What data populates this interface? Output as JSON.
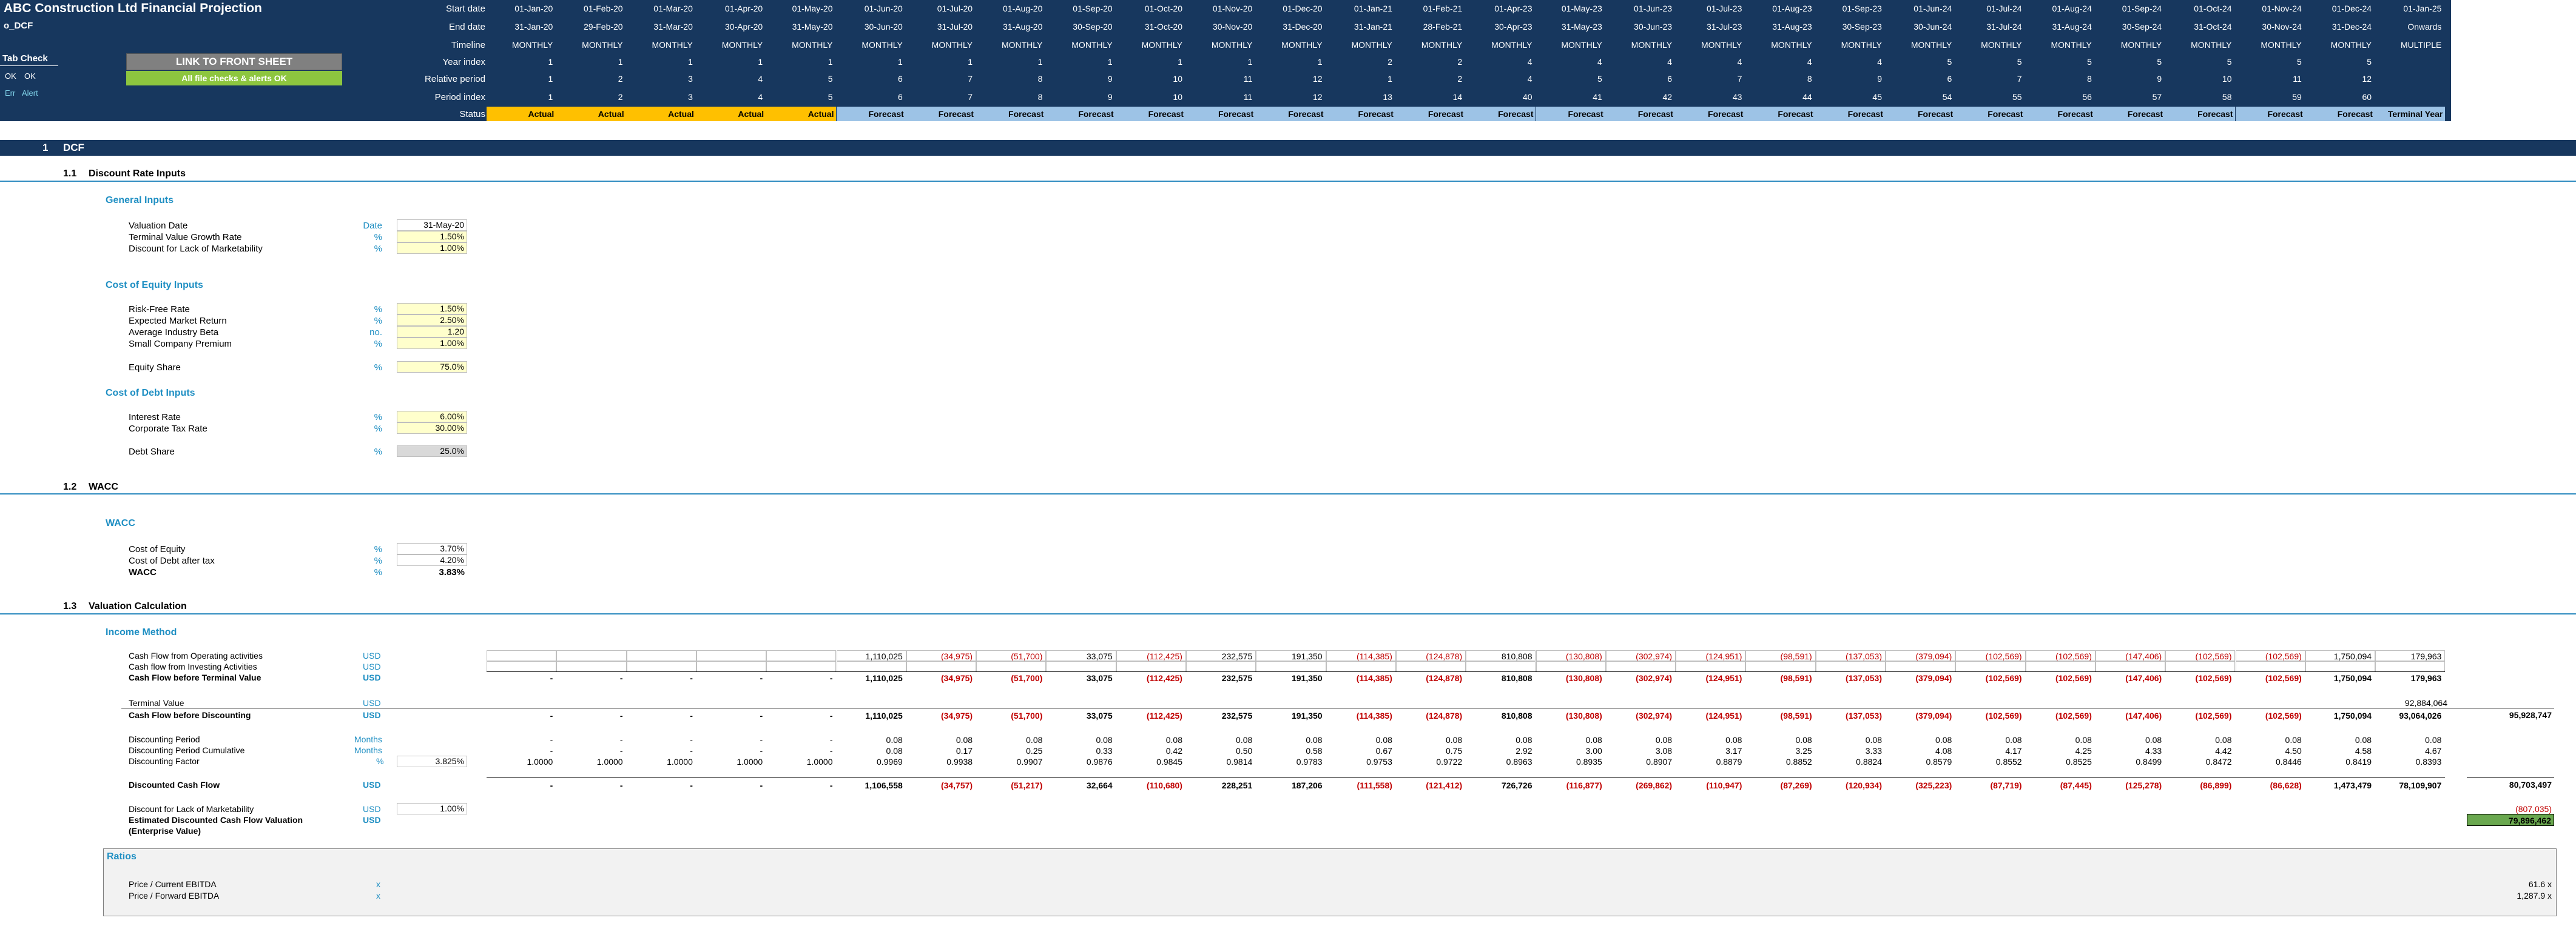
{
  "title": "ABC Construction Ltd Financial Projection",
  "sheet_name": "o_DCF",
  "tab_check": {
    "label": "Tab Check",
    "ok1": "OK",
    "ok2": "OK",
    "err": "Err",
    "alert": "Alert"
  },
  "link_button": "LINK TO FRONT SHEET",
  "checks_ok": "All file checks & alerts OK",
  "row_labels": {
    "start": "Start date",
    "end": "End date",
    "timeline": "Timeline",
    "year_index": "Year index",
    "relative": "Relative period",
    "period_index": "Period index",
    "status": "Status"
  },
  "timeline": {
    "start": [
      "01-Jan-20",
      "01-Feb-20",
      "01-Mar-20",
      "01-Apr-20",
      "01-May-20",
      "01-Jun-20",
      "01-Jul-20",
      "01-Aug-20",
      "01-Sep-20",
      "01-Oct-20",
      "01-Nov-20",
      "01-Dec-20",
      "01-Jan-21",
      "01-Feb-21",
      "01-Apr-23",
      "01-May-23",
      "01-Jun-23",
      "01-Jul-23",
      "01-Aug-23",
      "01-Sep-23",
      "01-Jun-24",
      "01-Jul-24",
      "01-Aug-24",
      "01-Sep-24",
      "01-Oct-24",
      "01-Nov-24",
      "01-Dec-24",
      "01-Jan-25"
    ],
    "end": [
      "31-Jan-20",
      "29-Feb-20",
      "31-Mar-20",
      "30-Apr-20",
      "31-May-20",
      "30-Jun-20",
      "31-Jul-20",
      "31-Aug-20",
      "30-Sep-20",
      "31-Oct-20",
      "30-Nov-20",
      "31-Dec-20",
      "31-Jan-21",
      "28-Feb-21",
      "30-Apr-23",
      "31-May-23",
      "30-Jun-23",
      "31-Jul-23",
      "31-Aug-23",
      "30-Sep-23",
      "30-Jun-24",
      "31-Jul-24",
      "31-Aug-24",
      "30-Sep-24",
      "31-Oct-24",
      "30-Nov-24",
      "31-Dec-24",
      "Onwards"
    ],
    "type": [
      "MONTHLY",
      "MONTHLY",
      "MONTHLY",
      "MONTHLY",
      "MONTHLY",
      "MONTHLY",
      "MONTHLY",
      "MONTHLY",
      "MONTHLY",
      "MONTHLY",
      "MONTHLY",
      "MONTHLY",
      "MONTHLY",
      "MONTHLY",
      "MONTHLY",
      "MONTHLY",
      "MONTHLY",
      "MONTHLY",
      "MONTHLY",
      "MONTHLY",
      "MONTHLY",
      "MONTHLY",
      "MONTHLY",
      "MONTHLY",
      "MONTHLY",
      "MONTHLY",
      "MONTHLY",
      "MULTIPLE"
    ],
    "year_index": [
      "1",
      "1",
      "1",
      "1",
      "1",
      "1",
      "1",
      "1",
      "1",
      "1",
      "1",
      "1",
      "2",
      "2",
      "4",
      "4",
      "4",
      "4",
      "4",
      "4",
      "5",
      "5",
      "5",
      "5",
      "5",
      "5",
      "5",
      ""
    ],
    "relative": [
      "1",
      "2",
      "3",
      "4",
      "5",
      "6",
      "7",
      "8",
      "9",
      "10",
      "11",
      "12",
      "1",
      "2",
      "4",
      "5",
      "6",
      "7",
      "8",
      "9",
      "6",
      "7",
      "8",
      "9",
      "10",
      "11",
      "12",
      ""
    ],
    "period_index": [
      "1",
      "2",
      "3",
      "4",
      "5",
      "6",
      "7",
      "8",
      "9",
      "10",
      "11",
      "12",
      "13",
      "14",
      "40",
      "41",
      "42",
      "43",
      "44",
      "45",
      "54",
      "55",
      "56",
      "57",
      "58",
      "59",
      "60",
      ""
    ],
    "status": [
      "Actual",
      "Actual",
      "Actual",
      "Actual",
      "Actual",
      "Forecast",
      "Forecast",
      "Forecast",
      "Forecast",
      "Forecast",
      "Forecast",
      "Forecast",
      "Forecast",
      "Forecast",
      "Forecast",
      "Forecast",
      "Forecast",
      "Forecast",
      "Forecast",
      "Forecast",
      "Forecast",
      "Forecast",
      "Forecast",
      "Forecast",
      "Forecast",
      "Forecast",
      "Forecast",
      "Terminal Year"
    ]
  },
  "colors": {
    "navy": "#17375E",
    "actual": "#FFC000",
    "forecast": "#9DC3E6",
    "input": "#FFFFCC",
    "teal": "#1F8FC3",
    "negative": "#C00000",
    "green": "#6AA84F"
  },
  "sec1": {
    "num": "1",
    "title": "DCF"
  },
  "sec11": {
    "num": "1.1",
    "title": "Discount Rate Inputs"
  },
  "general": {
    "heading": "General Inputs",
    "rows": [
      {
        "label": "Valuation Date",
        "unit": "Date",
        "value": "31-May-20"
      },
      {
        "label": "Terminal Value Growth Rate",
        "unit": "%",
        "value": "1.50%"
      },
      {
        "label": "Discount for Lack of Marketability",
        "unit": "%",
        "value": "1.00%"
      }
    ]
  },
  "equity": {
    "heading": "Cost of Equity Inputs",
    "rows": [
      {
        "label": "Risk-Free Rate",
        "unit": "%",
        "value": "1.50%"
      },
      {
        "label": "Expected Market Return",
        "unit": "%",
        "value": "2.50%"
      },
      {
        "label": "Average Industry Beta",
        "unit": "no.",
        "value": "1.20"
      },
      {
        "label": "Small Company Premium",
        "unit": "%",
        "value": "1.00%"
      }
    ],
    "share": {
      "label": "Equity Share",
      "unit": "%",
      "value": "75.0%"
    }
  },
  "debt": {
    "heading": "Cost of Debt Inputs",
    "rows": [
      {
        "label": "Interest Rate",
        "unit": "%",
        "value": "6.00%"
      },
      {
        "label": "Corporate Tax Rate",
        "unit": "%",
        "value": "30.00%"
      }
    ],
    "share": {
      "label": "Debt Share",
      "unit": "%",
      "value": "25.0%"
    }
  },
  "sec12": {
    "num": "1.2",
    "title": "WACC"
  },
  "wacc": {
    "heading": "WACC",
    "rows": [
      {
        "label": "Cost of Equity",
        "unit": "%",
        "value": "3.70%"
      },
      {
        "label": "Cost of Debt after tax",
        "unit": "%",
        "value": "4.20%"
      },
      {
        "label": "WACC",
        "unit": "%",
        "value": "3.83%"
      }
    ]
  },
  "sec13": {
    "num": "1.3",
    "title": "Valuation Calculation"
  },
  "income": {
    "heading": "Income Method",
    "cfo": {
      "label": "Cash Flow from Operating activities",
      "unit": "USD",
      "values": [
        "",
        "",
        "",
        "",
        "",
        "1,110,025",
        "(34,975)",
        "(51,700)",
        "33,075",
        "(112,425)",
        "232,575",
        "191,350",
        "(114,385)",
        "(124,878)",
        "810,808",
        "(130,808)",
        "(302,974)",
        "(124,951)",
        "(98,591)",
        "(137,053)",
        "(379,094)",
        "(102,569)",
        "(102,569)",
        "(147,406)",
        "(102,569)",
        "(102,569)",
        "1,750,094",
        "179,963"
      ]
    },
    "cfi": {
      "label": "Cash flow from Investing Activities",
      "unit": "USD"
    },
    "cfbtv": {
      "label": "Cash Flow before Terminal Value",
      "unit": "USD",
      "values": [
        "-",
        "-",
        "-",
        "-",
        "-",
        "1,110,025",
        "(34,975)",
        "(51,700)",
        "33,075",
        "(112,425)",
        "232,575",
        "191,350",
        "(114,385)",
        "(124,878)",
        "810,808",
        "(130,808)",
        "(302,974)",
        "(124,951)",
        "(98,591)",
        "(137,053)",
        "(379,094)",
        "(102,569)",
        "(102,569)",
        "(147,406)",
        "(102,569)",
        "(102,569)",
        "1,750,094",
        "179,963"
      ]
    },
    "tv": {
      "label": "Terminal Value",
      "unit": "USD",
      "value": "92,884,064"
    },
    "cfbd": {
      "label": "Cash Flow before Discounting",
      "unit": "USD",
      "values": [
        "-",
        "-",
        "-",
        "-",
        "-",
        "1,110,025",
        "(34,975)",
        "(51,700)",
        "33,075",
        "(112,425)",
        "232,575",
        "191,350",
        "(114,385)",
        "(124,878)",
        "810,808",
        "(130,808)",
        "(302,974)",
        "(124,951)",
        "(98,591)",
        "(137,053)",
        "(379,094)",
        "(102,569)",
        "(102,569)",
        "(147,406)",
        "(102,569)",
        "(102,569)",
        "1,750,094",
        "93,064,026"
      ],
      "total": "95,928,747"
    },
    "dp": {
      "label": "Discounting Period",
      "unit": "Months",
      "values": [
        "-",
        "-",
        "-",
        "-",
        "-",
        "0.08",
        "0.08",
        "0.08",
        "0.08",
        "0.08",
        "0.08",
        "0.08",
        "0.08",
        "0.08",
        "0.08",
        "0.08",
        "0.08",
        "0.08",
        "0.08",
        "0.08",
        "0.08",
        "0.08",
        "0.08",
        "0.08",
        "0.08",
        "0.08",
        "0.08",
        "0.08"
      ]
    },
    "dpc": {
      "label": "Discounting Period Cumulative",
      "unit": "Months",
      "values": [
        "-",
        "-",
        "-",
        "-",
        "-",
        "0.08",
        "0.17",
        "0.25",
        "0.33",
        "0.42",
        "0.50",
        "0.58",
        "0.67",
        "0.75",
        "2.92",
        "3.00",
        "3.08",
        "3.17",
        "3.25",
        "3.33",
        "4.08",
        "4.17",
        "4.25",
        "4.33",
        "4.42",
        "4.50",
        "4.58",
        "4.67"
      ]
    },
    "df": {
      "label": "Discounting Factor",
      "unit": "%",
      "rate": "3.825%",
      "values": [
        "1.0000",
        "1.0000",
        "1.0000",
        "1.0000",
        "1.0000",
        "0.9969",
        "0.9938",
        "0.9907",
        "0.9876",
        "0.9845",
        "0.9814",
        "0.9783",
        "0.9753",
        "0.9722",
        "0.8963",
        "0.8935",
        "0.8907",
        "0.8879",
        "0.8852",
        "0.8824",
        "0.8579",
        "0.8552",
        "0.8525",
        "0.8499",
        "0.8472",
        "0.8446",
        "0.8419",
        "0.8393"
      ]
    },
    "dcf": {
      "label": "Discounted Cash Flow",
      "unit": "USD",
      "values": [
        "-",
        "-",
        "-",
        "-",
        "-",
        "1,106,558",
        "(34,757)",
        "(51,217)",
        "32,664",
        "(110,680)",
        "228,251",
        "187,206",
        "(111,558)",
        "(121,412)",
        "726,726",
        "(116,877)",
        "(269,862)",
        "(110,947)",
        "(87,269)",
        "(120,934)",
        "(325,223)",
        "(87,719)",
        "(87,445)",
        "(125,278)",
        "(86,899)",
        "(86,628)",
        "1,473,479",
        "78,109,907"
      ],
      "total": "80,703,497"
    },
    "dlm": {
      "label": "Discount for Lack of Marketability",
      "unit": "USD",
      "rate": "1.00%",
      "total": "(807,035)"
    },
    "edcf": {
      "label": "Estimated Discounted Cash Flow Valuation",
      "label2": "(Enterprise Value)",
      "unit": "USD",
      "total": "79,896,462"
    }
  },
  "ratios": {
    "heading": "Ratios",
    "rows": [
      {
        "label": "Price / Current EBITDA",
        "unit": "x",
        "value": "61.6 x"
      },
      {
        "label": "Price / Forward EBITDA",
        "unit": "x",
        "value": "1,287.9 x"
      }
    ]
  }
}
